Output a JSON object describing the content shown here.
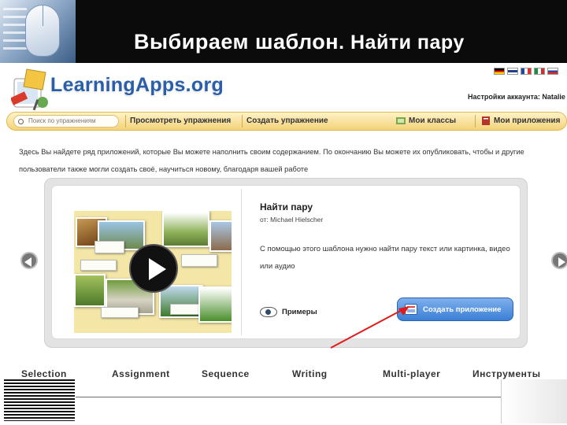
{
  "slide": {
    "title_part1": "Выбираем шаблон",
    "title_part2": ". Найти пару"
  },
  "site": {
    "logo_text": "LearningApps.org",
    "account_label": "Настройки аккаунта: Natalie"
  },
  "nav": {
    "search_placeholder": "Поиск по упражнениям",
    "items": [
      "Просмотреть упражнения",
      "Создать упражнение",
      "Мои классы",
      "Мои приложения"
    ]
  },
  "intro": {
    "line1": "Здесь Вы найдете ряд приложений, которые Вы можете наполнить своим содержанием. По окончанию Вы можете их опубликовать, чтобы и другие",
    "line2": "пользователи также могли создать своё, научиться новому, благодаря вашей работе"
  },
  "app": {
    "title": "Найти пару",
    "author": "от: Michael Hielscher",
    "description": "С помощью этого шаблона нужно найти пару текст или картинка, видео или аудио",
    "examples_label": "Примеры",
    "create_label": "Создать приложение"
  },
  "categories": [
    "Selection",
    "Assignment",
    "Sequence",
    "Writing",
    "Multi-player",
    "Инструменты"
  ],
  "colors": {
    "brand_blue": "#2b5ea8",
    "nav_yellow": "#f3d27a",
    "button_blue": "#3a7fd6",
    "annotation_red": "#e01b1b"
  }
}
